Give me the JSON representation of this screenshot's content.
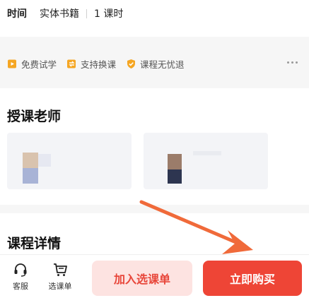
{
  "info": {
    "label": "时间",
    "items": [
      "实体书籍",
      "1 课时"
    ]
  },
  "features": [
    {
      "label": "免费试学",
      "icon": "play-book-icon",
      "color": "#f5a623"
    },
    {
      "label": "支持换课",
      "icon": "exchange-icon",
      "color": "#f5a623"
    },
    {
      "label": "课程无忧退",
      "icon": "shield-check-icon",
      "color": "#f5a623"
    }
  ],
  "teachers": {
    "title": "授课老师"
  },
  "details": {
    "title": "课程详情"
  },
  "bottom_bar": {
    "service_label": "客服",
    "cart_label": "选课单",
    "add_label": "加入选课单",
    "buy_label": "立即购买"
  },
  "colors": {
    "accent": "#ee4536",
    "accent_light": "#fde3e1",
    "feature_icon": "#f5a623",
    "annotation_arrow": "#f06a3a"
  }
}
